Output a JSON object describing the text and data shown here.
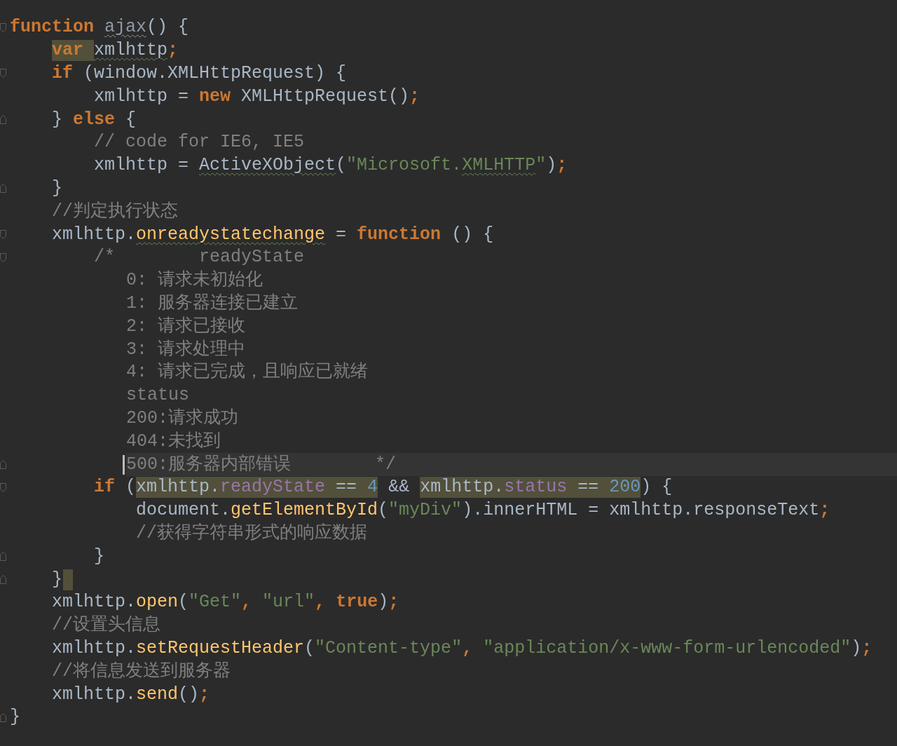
{
  "editor": {
    "lines": [
      {
        "kind": "fold-start",
        "tokens": [
          {
            "text": "function ",
            "kind": "kw"
          },
          {
            "text": "ajax",
            "kind": "dim",
            "warning": true
          },
          {
            "text": "() {",
            "kind": "plain"
          }
        ],
        "children": [
          {
            "kind": "plain",
            "tokens": [
              {
                "text": "var ",
                "kind": "kw",
                "highlight": true
              },
              {
                "text": "xmlhttp",
                "kind": "plain",
                "warning": true
              },
              {
                "text": ";",
                "kind": "kw"
              }
            ]
          },
          {
            "kind": "fold-start",
            "tokens": [
              {
                "text": "if ",
                "kind": "kw"
              },
              {
                "text": "(window.XMLHttpRequest) {",
                "kind": "plain"
              }
            ],
            "children": [
              {
                "kind": "plain",
                "tokens": [
                  {
                    "text": "xmlhttp = ",
                    "kind": "plain"
                  },
                  {
                    "text": "new ",
                    "kind": "kw"
                  },
                  {
                    "text": "XMLHttpRequest()",
                    "kind": "plain"
                  },
                  {
                    "text": ";",
                    "kind": "kw"
                  }
                ]
              }
            ]
          },
          {
            "kind": "fold-end",
            "tokens": [
              {
                "text": "} ",
                "kind": "plain"
              },
              {
                "text": "else ",
                "kind": "kw"
              },
              {
                "text": "{",
                "kind": "plain"
              }
            ],
            "children": [
              {
                "kind": "plain",
                "tokens": [
                  {
                    "text": "// code for IE6, IE5",
                    "kind": "cmt"
                  }
                ]
              },
              {
                "kind": "plain",
                "tokens": [
                  {
                    "text": "xmlhttp = ",
                    "kind": "plain"
                  },
                  {
                    "text": "ActiveXObject",
                    "kind": "plain",
                    "warning": true
                  },
                  {
                    "text": "(",
                    "kind": "plain"
                  },
                  {
                    "text": "\"Microsoft.",
                    "kind": "str"
                  },
                  {
                    "text": "XMLHTTP",
                    "kind": "str",
                    "warning": true
                  },
                  {
                    "text": "\"",
                    "kind": "str"
                  },
                  {
                    "text": ")",
                    "kind": "plain"
                  },
                  {
                    "text": ";",
                    "kind": "kw"
                  }
                ]
              }
            ]
          },
          {
            "kind": "fold-end",
            "tokens": [
              {
                "text": "}",
                "kind": "plain"
              }
            ]
          },
          {
            "kind": "plain",
            "tokens": [
              {
                "text": "//判定执行状态",
                "kind": "cmt"
              }
            ]
          },
          {
            "kind": "fold-start",
            "tokens": [
              {
                "text": "xmlhttp.",
                "kind": "plain"
              },
              {
                "text": "onreadystatechange",
                "kind": "fn",
                "warning": true
              },
              {
                "text": " = ",
                "kind": "plain"
              },
              {
                "text": "function ",
                "kind": "kw"
              },
              {
                "text": "() {",
                "kind": "plain"
              }
            ],
            "children": [
              {
                "kind": "fold-start",
                "tokens": [
                  {
                    "text": "/*        readyState",
                    "kind": "cmt"
                  }
                ],
                "children": [
                  {
                    "kind": "plain",
                    "tokens": [
                      {
                        "text": "0: 请求未初始化",
                        "kind": "cmt"
                      }
                    ]
                  },
                  {
                    "kind": "plain",
                    "tokens": [
                      {
                        "text": "1: 服务器连接已建立",
                        "kind": "cmt"
                      }
                    ]
                  },
                  {
                    "kind": "plain",
                    "tokens": [
                      {
                        "text": "2: 请求已接收",
                        "kind": "cmt"
                      }
                    ]
                  },
                  {
                    "kind": "plain",
                    "tokens": [
                      {
                        "text": "3: 请求处理中",
                        "kind": "cmt"
                      }
                    ]
                  },
                  {
                    "kind": "plain",
                    "tokens": [
                      {
                        "text": "4: 请求已完成，且响应已就绪",
                        "kind": "cmt"
                      }
                    ]
                  },
                  {
                    "kind": "plain",
                    "tokens": [
                      {
                        "text": "status",
                        "kind": "cmt"
                      }
                    ]
                  },
                  {
                    "kind": "plain",
                    "tokens": [
                      {
                        "text": "200:请求成功",
                        "kind": "cmt"
                      }
                    ]
                  },
                  {
                    "kind": "plain",
                    "tokens": [
                      {
                        "text": "404:未找到",
                        "kind": "cmt"
                      }
                    ]
                  },
                  {
                    "current": true,
                    "caret": true,
                    "kind": "fold-end",
                    "tokens": [
                      {
                        "text": "500:服务器内部错误        */",
                        "kind": "cmt"
                      }
                    ]
                  }
                ]
              },
              {
                "kind": "fold-start",
                "tokens": [
                  {
                    "text": "if ",
                    "kind": "kw"
                  },
                  {
                    "text": "(",
                    "kind": "plain"
                  },
                  {
                    "text": "xmlhttp.",
                    "kind": "plain",
                    "highlight": true
                  },
                  {
                    "text": "readyState",
                    "kind": "prop",
                    "highlight": true
                  },
                  {
                    "text": " == ",
                    "kind": "plain",
                    "highlight": true
                  },
                  {
                    "text": "4",
                    "kind": "num",
                    "highlight": true
                  },
                  {
                    "text": " && ",
                    "kind": "plain"
                  },
                  {
                    "text": "xmlhttp.",
                    "kind": "plain",
                    "highlight": true
                  },
                  {
                    "text": "status",
                    "kind": "prop",
                    "highlight": true
                  },
                  {
                    "text": " == ",
                    "kind": "plain",
                    "highlight": true
                  },
                  {
                    "text": "200",
                    "kind": "num",
                    "highlight": true
                  },
                  {
                    "text": ") {",
                    "kind": "plain"
                  }
                ],
                "children": [
                  {
                    "kind": "plain",
                    "tokens": [
                      {
                        "text": "document.",
                        "kind": "plain"
                      },
                      {
                        "text": "getElementById",
                        "kind": "fn"
                      },
                      {
                        "text": "(",
                        "kind": "plain"
                      },
                      {
                        "text": "\"myDiv\"",
                        "kind": "str"
                      },
                      {
                        "text": ").innerHTML = xmlhttp.responseText",
                        "kind": "plain"
                      },
                      {
                        "text": ";",
                        "kind": "kw"
                      }
                    ]
                  },
                  {
                    "kind": "plain",
                    "tokens": [
                      {
                        "text": "//获得字符串形式的响应数据",
                        "kind": "cmt"
                      }
                    ]
                  }
                ]
              },
              {
                "kind": "fold-end",
                "tokens": [
                  {
                    "text": "}",
                    "kind": "plain"
                  }
                ]
              }
            ]
          },
          {
            "kind": "fold-end",
            "brace_match": true,
            "tokens": [
              {
                "text": "}",
                "kind": "plain"
              }
            ]
          },
          {
            "kind": "plain",
            "tokens": [
              {
                "text": "xmlhttp.",
                "kind": "plain"
              },
              {
                "text": "open",
                "kind": "fn"
              },
              {
                "text": "(",
                "kind": "plain"
              },
              {
                "text": "\"Get\"",
                "kind": "str"
              },
              {
                "text": ", ",
                "kind": "kw"
              },
              {
                "text": "\"url\"",
                "kind": "str"
              },
              {
                "text": ", ",
                "kind": "kw"
              },
              {
                "text": "true",
                "kind": "kw"
              },
              {
                "text": ")",
                "kind": "plain"
              },
              {
                "text": ";",
                "kind": "kw"
              }
            ]
          },
          {
            "kind": "plain",
            "tokens": [
              {
                "text": "//设置头信息",
                "kind": "cmt"
              }
            ]
          },
          {
            "kind": "plain",
            "tokens": [
              {
                "text": "xmlhttp.",
                "kind": "plain"
              },
              {
                "text": "setRequestHeader",
                "kind": "fn"
              },
              {
                "text": "(",
                "kind": "plain"
              },
              {
                "text": "\"Content-type\"",
                "kind": "str"
              },
              {
                "text": ", ",
                "kind": "kw"
              },
              {
                "text": "\"application/x-www-form-urlencoded\"",
                "kind": "str"
              },
              {
                "text": ")",
                "kind": "plain"
              },
              {
                "text": ";",
                "kind": "kw"
              }
            ]
          },
          {
            "kind": "plain",
            "tokens": [
              {
                "text": "//将信息发送到服务器",
                "kind": "cmt"
              }
            ]
          },
          {
            "kind": "plain",
            "tokens": [
              {
                "text": "xmlhttp.",
                "kind": "plain"
              },
              {
                "text": "send",
                "kind": "fn"
              },
              {
                "text": "()",
                "kind": "plain"
              },
              {
                "text": ";",
                "kind": "kw"
              }
            ]
          }
        ]
      },
      {
        "kind": "fold-end",
        "tokens": [
          {
            "text": "}",
            "kind": "plain"
          }
        ]
      }
    ]
  }
}
